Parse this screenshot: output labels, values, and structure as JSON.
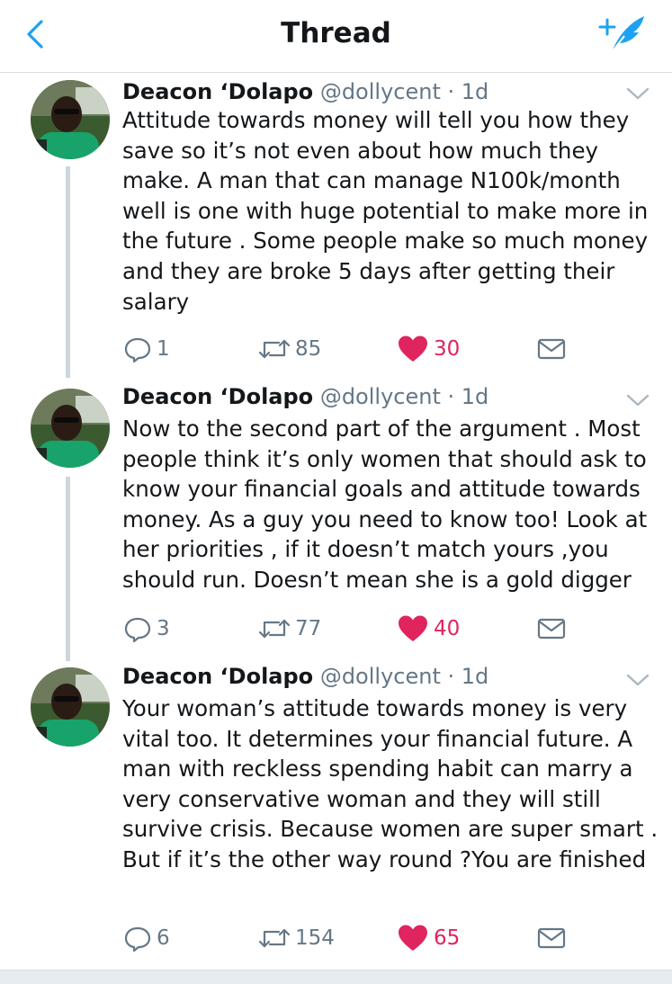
{
  "header": {
    "title": "Thread",
    "back_icon": "chevron-left-icon",
    "compose_icon": "compose-tweet-icon",
    "accent": "#1da1f2"
  },
  "tweets": [
    {
      "name": "Deacon ‘Dolapo",
      "handle": "@dollycent",
      "time": "· 1d",
      "text": "Attitude towards money will tell you how they save so it’s not even about how much they make. A man that can manage N100k/month well is one with huge potential to make more in the future . Some people make so much money and they are broke 5 days after getting their salary",
      "replies": "1",
      "retweets": "85",
      "likes": "30"
    },
    {
      "name": "Deacon ‘Dolapo",
      "handle": "@dollycent",
      "time": "· 1d",
      "text": "Now to the second part of the argument . Most people think it’s only women that should ask to know your financial goals and attitude towards money. As a guy you need to know too! Look at her priorities , if it doesn’t match yours ,you should run. Doesn’t mean she is a gold digger",
      "replies": "3",
      "retweets": "77",
      "likes": "40"
    },
    {
      "name": "Deacon ‘Dolapo",
      "handle": "@dollycent",
      "time": "· 1d",
      "text": "Your woman’s attitude towards money is very vital too. It determines your financial future. A man with reckless spending habit can marry a very conservative woman and they will still survive crisis. Because women are super smart . But if it’s the other way round ?You are finished",
      "replies": "6",
      "retweets": "154",
      "likes": "65"
    }
  ],
  "colors": {
    "like": "#e0245e",
    "meta": "#657786",
    "thread_line": "#ccd6dd"
  }
}
